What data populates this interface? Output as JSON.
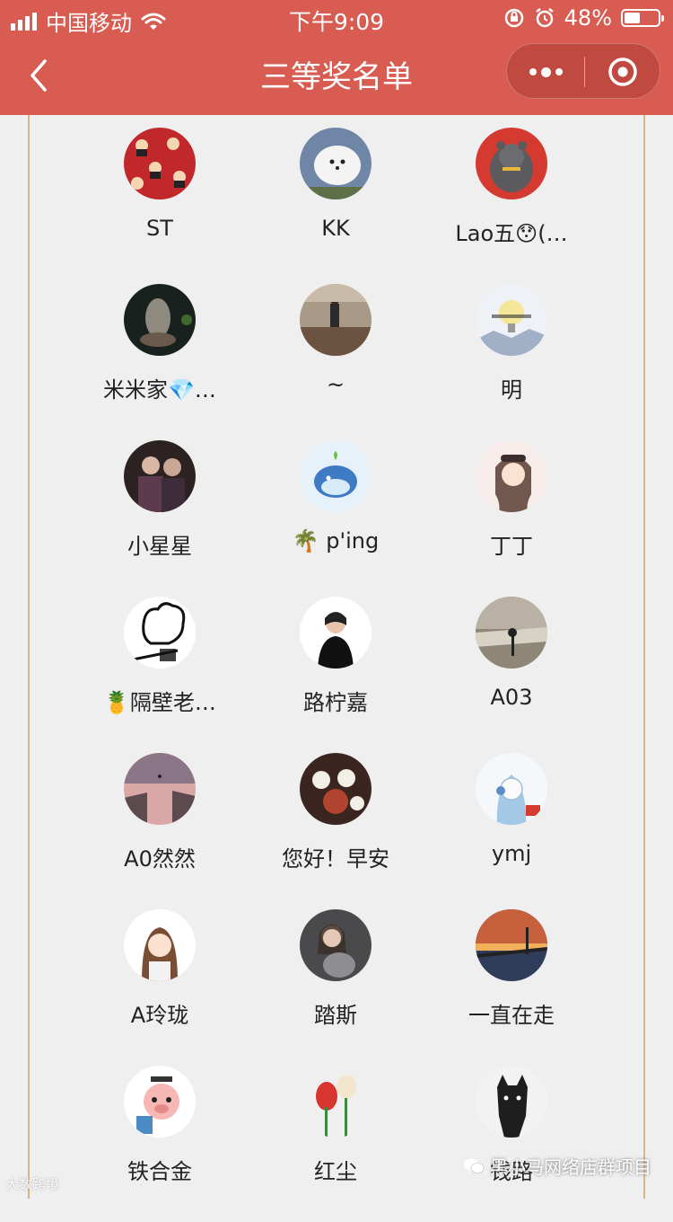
{
  "status_bar": {
    "carrier": "中国移动",
    "time": "下午9:09",
    "battery": "48%",
    "battery_level": 0.48
  },
  "nav": {
    "title": "三等奖名单"
  },
  "winners": [
    {
      "name": "ST",
      "avatar": "red-pattern-avatar"
    },
    {
      "name": "KK",
      "avatar": "white-dog-avatar"
    },
    {
      "name": "Lao五😯(…",
      "avatar": "bear-avatar"
    },
    {
      "name": "米米家💎…",
      "avatar": "dark-sculpture-avatar"
    },
    {
      "name": "~",
      "avatar": "person-walking-avatar"
    },
    {
      "name": "明",
      "avatar": "lightbulb-avatar"
    },
    {
      "name": "小星星",
      "avatar": "family-photo-avatar"
    },
    {
      "name": "🌴 p'ing",
      "avatar": "whale-avatar"
    },
    {
      "name": "丁丁",
      "avatar": "cartoon-girl-avatar"
    },
    {
      "name": "🍍隔壁老…",
      "avatar": "sketch-bear-avatar"
    },
    {
      "name": "路柠嘉",
      "avatar": "woman-portrait-avatar"
    },
    {
      "name": "A03",
      "avatar": "landscape-bw-avatar"
    },
    {
      "name": "A0然然",
      "avatar": "cliff-sunset-avatar"
    },
    {
      "name": "您好！早安",
      "avatar": "tea-set-avatar"
    },
    {
      "name": "ymj",
      "avatar": "headphone-girl-avatar"
    },
    {
      "name": "A玲珑",
      "avatar": "cartoon-woman-avatar"
    },
    {
      "name": "踏斯",
      "avatar": "woman-with-cat-avatar"
    },
    {
      "name": "一直在走",
      "avatar": "bridge-sunset-avatar"
    },
    {
      "name": "铁合金",
      "avatar": "cartoon-pig-avatar"
    },
    {
      "name": "红尘",
      "avatar": "tulip-avatar"
    },
    {
      "name": "钱路",
      "avatar": "bulldog-avatar"
    }
  ],
  "watermarks": {
    "left": "大数跨境",
    "right": "黑小马网络店群项目"
  },
  "colors": {
    "header": "#d85c51",
    "frame_border": "#d8b48c",
    "background": "#efefef"
  }
}
